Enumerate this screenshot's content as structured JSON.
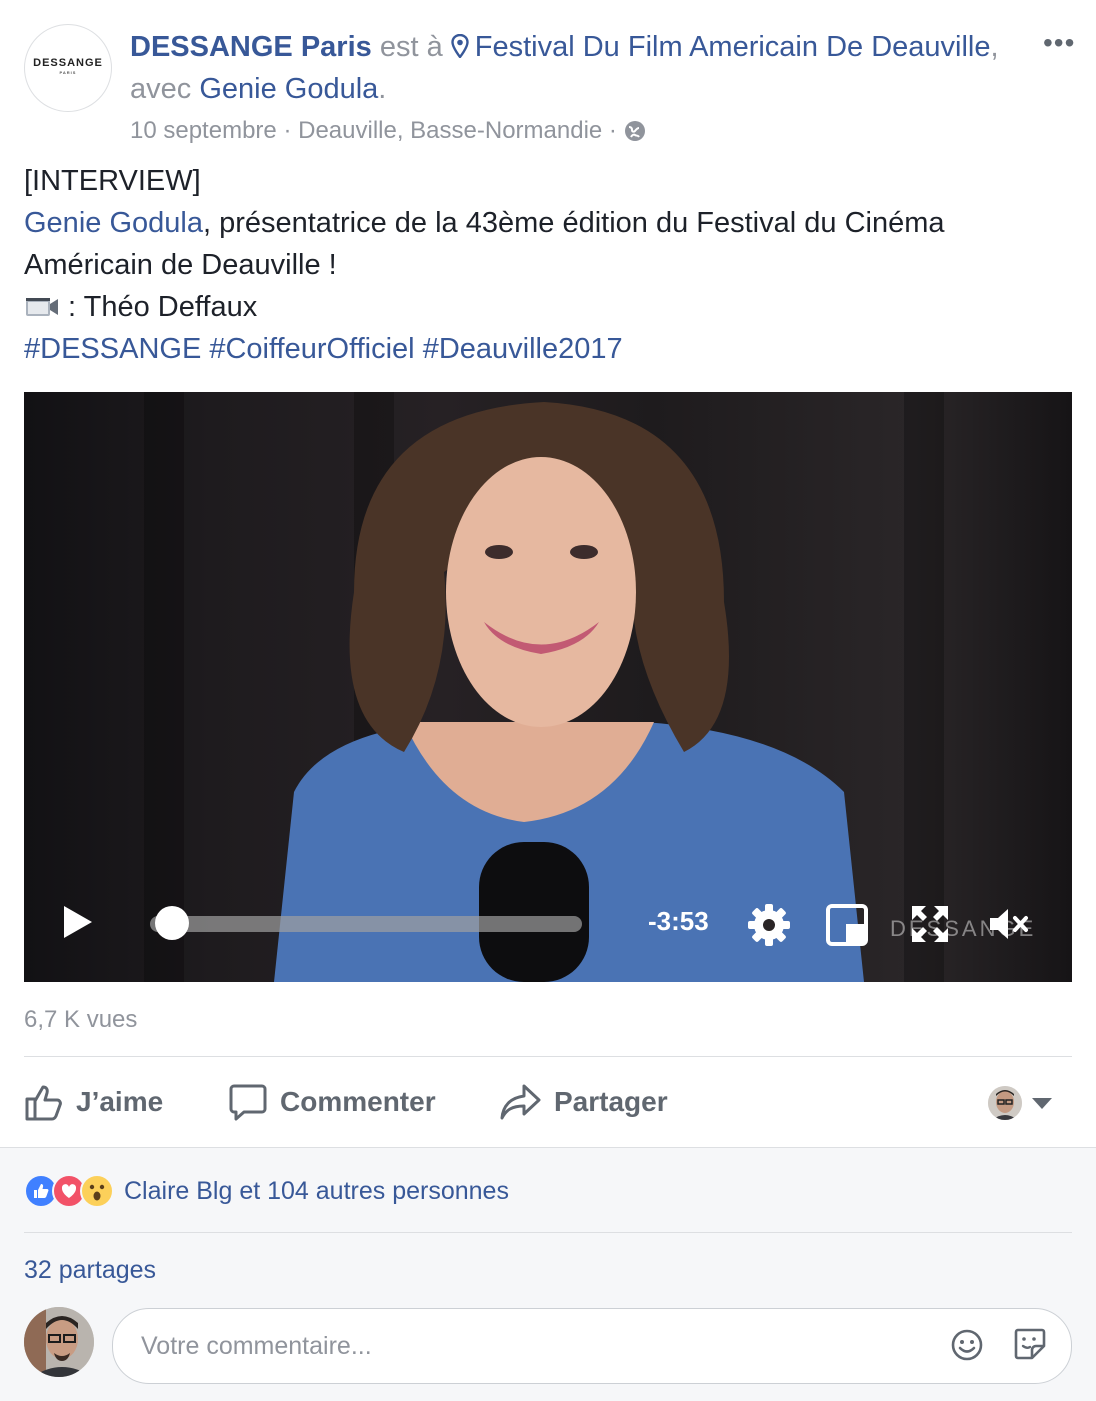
{
  "post": {
    "page_name": "DESSANGE Paris",
    "logo_text": "DESSANGE",
    "logo_sub": "PARIS",
    "est_a": "est à",
    "place": "Festival Du Film Americain De Deauville",
    "avec": ", avec",
    "tagged": "Genie Godula",
    "period": ".",
    "date": "10 septembre",
    "sep": "·",
    "location": "Deauville, Basse-Normandie",
    "more_label": "•••",
    "lines": {
      "interview": "[INTERVIEW]",
      "mention": "Genie Godula",
      "desc": ", présentatrice de la 43ème édition du Festival du Cinéma Américain de Deauville !",
      "credit": " : Théo Deffaux",
      "hashtags": [
        "#DESSANGE",
        "#CoiffeurOfficiel",
        "#Deauville2017"
      ]
    }
  },
  "video": {
    "remaining_time": "-3:53",
    "progress": 0.02,
    "watermark": "DESSANGE"
  },
  "stats": {
    "views": "6,7 K vues",
    "reactions_text": "Claire Blg et 104 autres personnes",
    "shares": "32 partages"
  },
  "actions": {
    "like": "J’aime",
    "comment": "Commenter",
    "share": "Partager"
  },
  "comment": {
    "placeholder": "Votre commentaire..."
  },
  "colors": {
    "link": "#385898",
    "muted": "#90949c",
    "like": "#4080ff",
    "love": "#f25268",
    "wow": "#fcd05a"
  }
}
